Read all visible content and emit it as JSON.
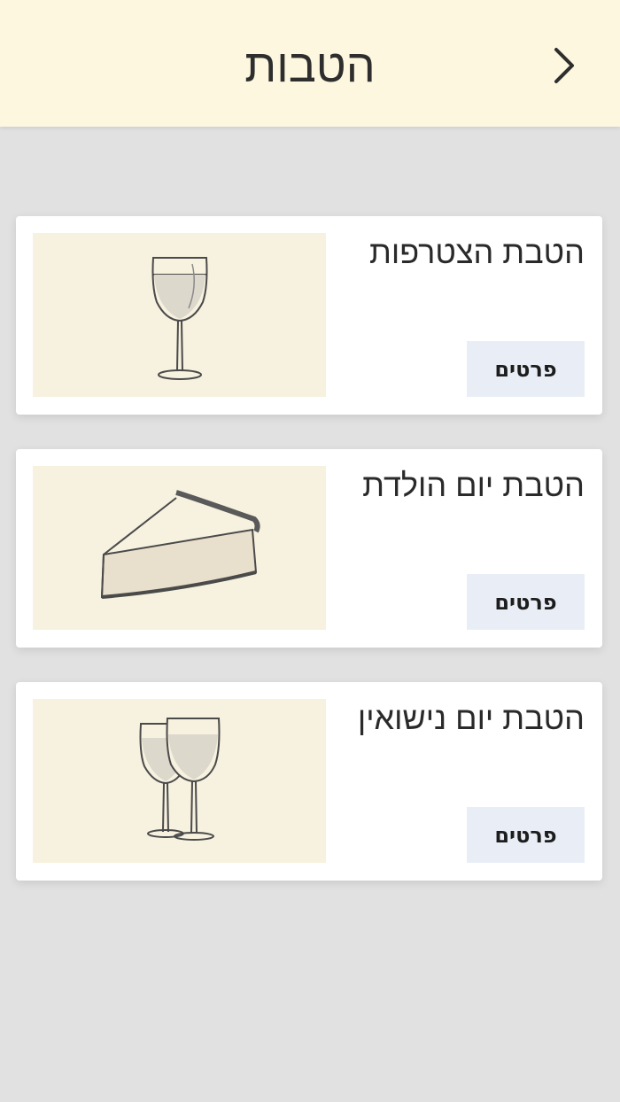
{
  "header": {
    "title": "הטבות",
    "back_icon": "chevron-right-icon"
  },
  "colors": {
    "header_bg": "#fdf7df",
    "page_bg": "#e1e1e1",
    "card_bg": "#ffffff",
    "button_bg": "#e9eef6",
    "image_bg": "#f7f1df"
  },
  "benefits": [
    {
      "title": "הטבת הצטרפות",
      "button_label": "פרטים",
      "image": "wine-glass-icon"
    },
    {
      "title": "הטבת יום הולדת",
      "button_label": "פרטים",
      "image": "cake-slice-icon"
    },
    {
      "title": "הטבת יום נישואין",
      "button_label": "פרטים",
      "image": "two-wine-glasses-icon"
    }
  ]
}
